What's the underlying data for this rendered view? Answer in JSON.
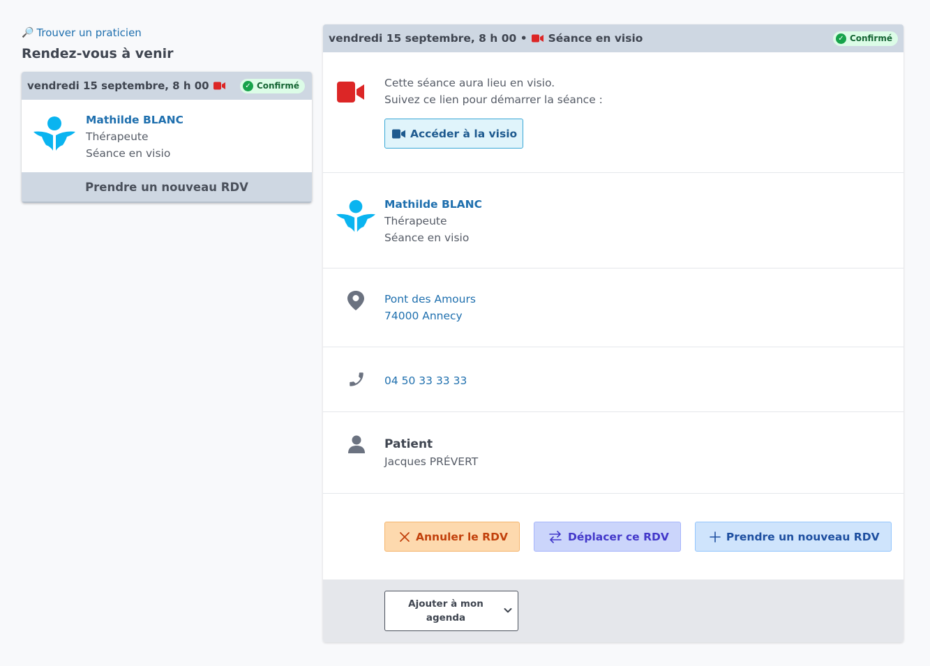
{
  "sidebar": {
    "find_link": "Trouver un praticien",
    "upcoming_title": "Rendez-vous à venir",
    "card": {
      "date": "vendredi 15 septembre, 8 h 00",
      "status": "Confirmé",
      "practitioner_name": "Mathilde BLANC",
      "practitioner_role": "Thérapeute",
      "session_type": "Séance en visio",
      "new_appointment": "Prendre un nouveau RDV"
    }
  },
  "detail": {
    "header": {
      "date": "vendredi 15 septembre, 8 h 00 •",
      "session_type": "Séance en visio",
      "status": "Confirmé"
    },
    "visio": {
      "line1": "Cette séance aura lieu en visio.",
      "line2": "Suivez ce lien pour démarrer la séance :",
      "button": "Accéder à la visio"
    },
    "practitioner": {
      "name": "Mathilde BLANC",
      "role": "Thérapeute",
      "session_type": "Séance en visio"
    },
    "address": {
      "line1": "Pont des Amours",
      "line2": "74000 Annecy"
    },
    "phone": "04 50 33 33 33",
    "patient": {
      "label": "Patient",
      "name": "Jacques PRÉVERT"
    },
    "actions": {
      "cancel": "Annuler le RDV",
      "move": "Déplacer ce RDV",
      "new": "Prendre un nouveau RDV"
    },
    "agenda": {
      "line1": "Ajouter à mon",
      "line2": "agenda"
    }
  },
  "colors": {
    "accent_blue": "#1e6fae",
    "logo_cyan": "#0ab4f0",
    "camera_red": "#dc2626",
    "confirmed_green": "#16a34a"
  }
}
